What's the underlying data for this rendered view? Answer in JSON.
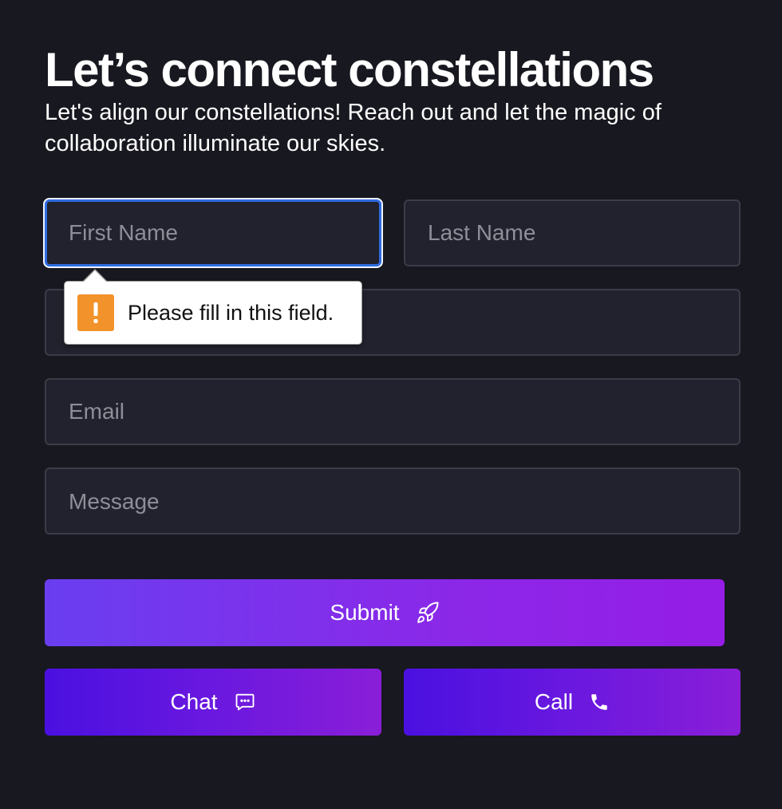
{
  "header": {
    "title": "Let’s connect constellations",
    "subtitle": "Let's align our constellations! Reach out and let the magic of collaboration illuminate our skies."
  },
  "form": {
    "first_name": {
      "placeholder": "First Name",
      "value": ""
    },
    "last_name": {
      "placeholder": "Last Name",
      "value": ""
    },
    "third_field": {
      "placeholder": "",
      "value": ""
    },
    "email": {
      "placeholder": "Email",
      "value": ""
    },
    "message": {
      "placeholder": "Message",
      "value": ""
    }
  },
  "validation": {
    "message": "Please fill in this field.",
    "icon": "warning-icon",
    "icon_color": "#f2922a"
  },
  "buttons": {
    "submit": {
      "label": "Submit",
      "icon": "rocket-icon"
    },
    "chat": {
      "label": "Chat",
      "icon": "chat-bubble-icon"
    },
    "call": {
      "label": "Call",
      "icon": "phone-icon"
    }
  },
  "colors": {
    "background": "#181820",
    "field_background": "#21222d",
    "field_border": "#3b3c48",
    "focus_border": "#2f6ce0",
    "submit_gradient_start": "#6a3ef0",
    "submit_gradient_end": "#951de6",
    "secondary_gradient_start": "#4a10e0",
    "secondary_gradient_end": "#8a1ed8"
  }
}
